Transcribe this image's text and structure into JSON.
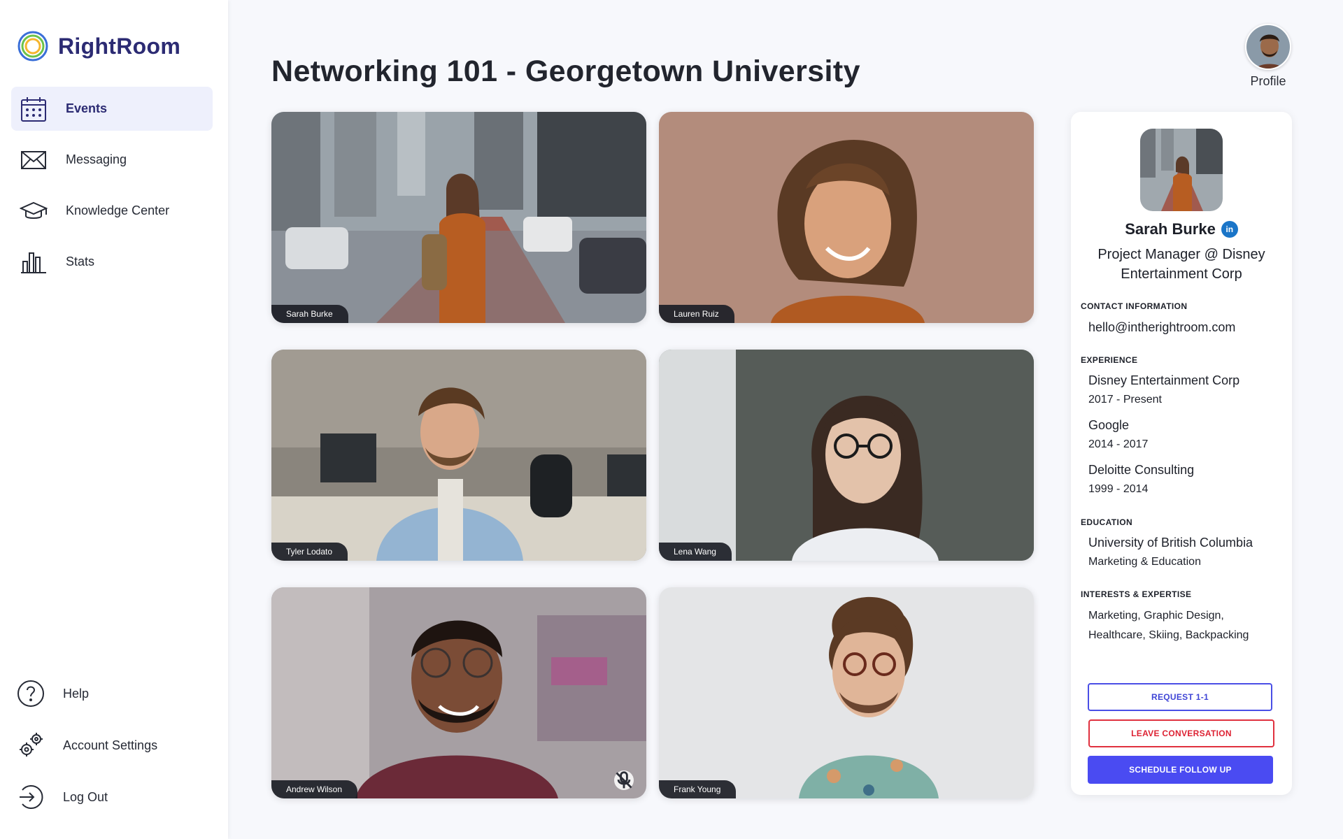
{
  "app": {
    "name": "RightRoom"
  },
  "sidebar": {
    "items": [
      {
        "label": "Events",
        "icon": "calendar-icon",
        "active": true
      },
      {
        "label": "Messaging",
        "icon": "envelope-icon",
        "active": false
      },
      {
        "label": "Knowledge Center",
        "icon": "graduation-cap-icon",
        "active": false
      },
      {
        "label": "Stats",
        "icon": "bar-chart-icon",
        "active": false
      }
    ],
    "bottom_items": [
      {
        "label": "Help",
        "icon": "question-icon"
      },
      {
        "label": "Account Settings",
        "icon": "gears-icon"
      },
      {
        "label": "Log Out",
        "icon": "logout-icon"
      }
    ]
  },
  "header": {
    "title": "Networking 101 - Georgetown University",
    "profile_label": "Profile"
  },
  "participants": [
    {
      "name": "Sarah Burke",
      "muted": false
    },
    {
      "name": "Lauren Ruiz",
      "muted": false
    },
    {
      "name": "Tyler Lodato",
      "muted": false
    },
    {
      "name": "Lena Wang",
      "muted": false
    },
    {
      "name": "Andrew Wilson",
      "muted": true
    },
    {
      "name": "Frank Young",
      "muted": false
    }
  ],
  "profile_panel": {
    "name": "Sarah Burke",
    "linkedin_label": "in",
    "role": "Project Manager @ Disney Entertainment Corp",
    "contact_heading": "CONTACT INFORMATION",
    "email": "hello@intherightroom.com",
    "experience_heading": "EXPERIENCE",
    "experience": [
      {
        "company": "Disney Entertainment Corp",
        "years": "2017 - Present"
      },
      {
        "company": "Google",
        "years": "2014 - 2017"
      },
      {
        "company": "Deloitte Consulting",
        "years": "1999 - 2014"
      }
    ],
    "education_heading": "EDUCATION",
    "education": {
      "school": "University of British Columbia",
      "field": "Marketing & Education"
    },
    "interests_heading": "INTERESTS & EXPERTISE",
    "interests": "Marketing, Graphic Design, Healthcare, Skiing, Backpacking",
    "buttons": {
      "request": "REQUEST 1-1",
      "leave": "LEAVE CONVERSATION",
      "schedule": "SCHEDULE FOLLOW UP"
    }
  },
  "colors": {
    "brand": "#2c2b73",
    "accent": "#4a4bf2",
    "danger": "#e0313f",
    "active_nav_bg": "#eef0fc"
  }
}
